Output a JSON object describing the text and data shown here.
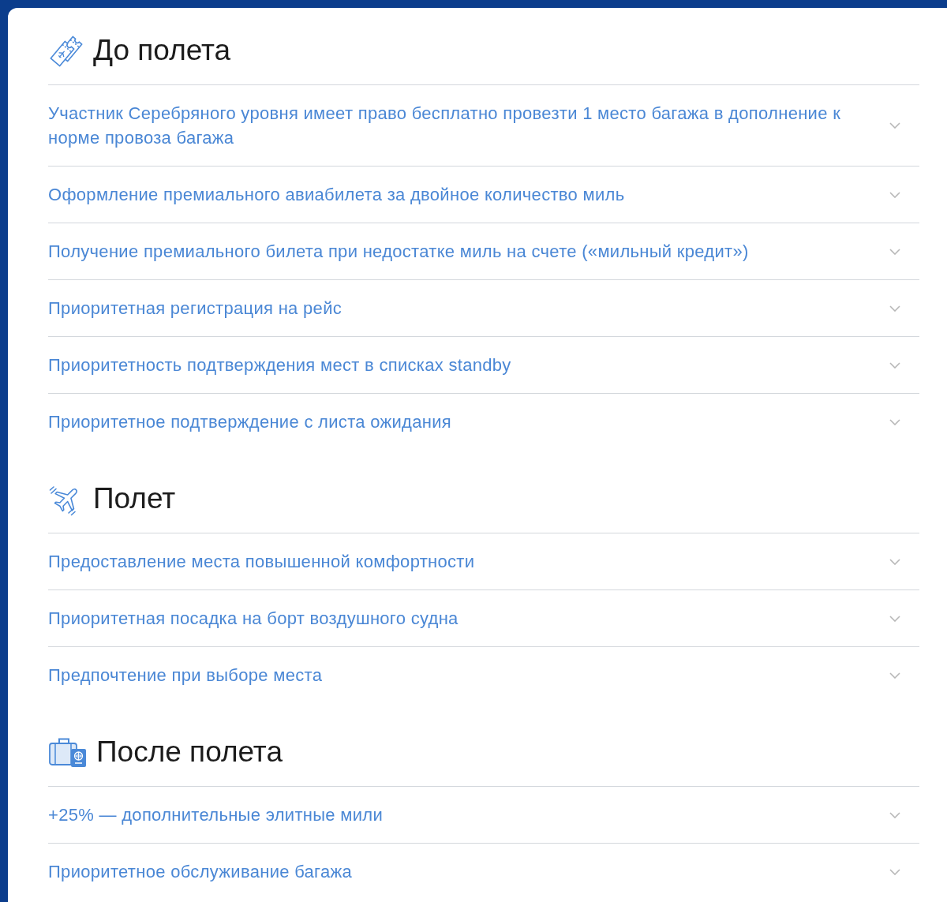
{
  "sections": [
    {
      "kind": "pre-flight",
      "title": "До полета",
      "items": [
        {
          "text": "Участник Серебряного уровня имеет право бесплатно провезти 1 место багажа в дополнение к норме провоза багажа",
          "expanded": false
        },
        {
          "text": "Оформление премиального авиабилета за двойное количество миль",
          "expanded": false
        },
        {
          "text": "Получение премиального билета при недостатке миль на счете («мильный кредит»)",
          "expanded": false
        },
        {
          "text": "Приоритетная регистрация на рейс",
          "expanded": false
        },
        {
          "text": "Приоритетность подтверждения мест в списках standby",
          "expanded": false
        },
        {
          "text": "Приоритетное подтверждение с листа ожидания",
          "expanded": false
        }
      ]
    },
    {
      "kind": "in-flight",
      "title": "Полет",
      "items": [
        {
          "text": "Предоставление места повышенной комфортности",
          "expanded": false
        },
        {
          "text": "Приоритетная посадка на борт воздушного судна",
          "expanded": false
        },
        {
          "text": "Предпочтение при выборе места",
          "expanded": false
        }
      ]
    },
    {
      "kind": "post-flight",
      "title": "После полета",
      "items": [
        {
          "text": "+25% — дополнительные элитные мили",
          "expanded": false
        },
        {
          "text": "Приоритетное обслуживание багажа",
          "expanded": false
        }
      ]
    }
  ]
}
